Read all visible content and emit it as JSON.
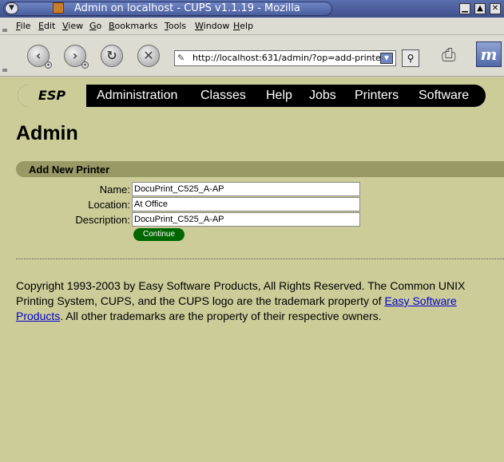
{
  "window": {
    "title": "Admin on localhost - CUPS v1.1.19 - Mozilla",
    "menu_icon": "window-menu-icon",
    "controls": [
      "minimize-icon",
      "maximize-icon",
      "close-icon"
    ]
  },
  "menubar": {
    "items": [
      {
        "label": "File",
        "key": "F",
        "rest": "ile"
      },
      {
        "label": "Edit",
        "key": "E",
        "rest": "dit"
      },
      {
        "label": "View",
        "key": "V",
        "rest": "iew"
      },
      {
        "label": "Go",
        "key": "G",
        "rest": "o"
      },
      {
        "label": "Bookmarks",
        "key": "B",
        "rest": "ookmarks"
      },
      {
        "label": "Tools",
        "key": "T",
        "rest": "ools"
      },
      {
        "label": "Window",
        "key": "W",
        "rest": "indow"
      },
      {
        "label": "Help",
        "key": "H",
        "rest": "elp"
      }
    ]
  },
  "navbar": {
    "url": "http://localhost:631/admin/?op=add-printe",
    "icons": [
      "back-icon",
      "forward-icon",
      "reload-icon",
      "stop-icon",
      "search-icon",
      "print-icon",
      "mozilla-throbber-icon"
    ]
  },
  "tabs": {
    "brand": "ESP",
    "items": [
      "Administration",
      "Classes",
      "Help",
      "Jobs",
      "Printers",
      "Software"
    ]
  },
  "page": {
    "heading": "Admin",
    "section_title": "Add New Printer",
    "form": {
      "name_label": "Name:",
      "name_value": "DocuPrint_C525_A-AP",
      "location_label": "Location:",
      "location_value": "At Office",
      "description_label": "Description:",
      "description_value": "DocuPrint_C525_A-AP",
      "continue_label": "Continue"
    },
    "footer": {
      "text_before": "Copyright 1993-2003 by Easy Software Products, All Rights Reserved. The Common UNIX Printing System, CUPS, and the CUPS logo are the trademark property of ",
      "link_text": "Easy Software Products",
      "text_after": ". All other trademarks are the property of their respective owners."
    }
  },
  "colors": {
    "page_background": "#cccc99",
    "section_bar": "#999966",
    "tab_bar": "#000000",
    "continue_button": "#006600",
    "link": "#0000cc"
  }
}
